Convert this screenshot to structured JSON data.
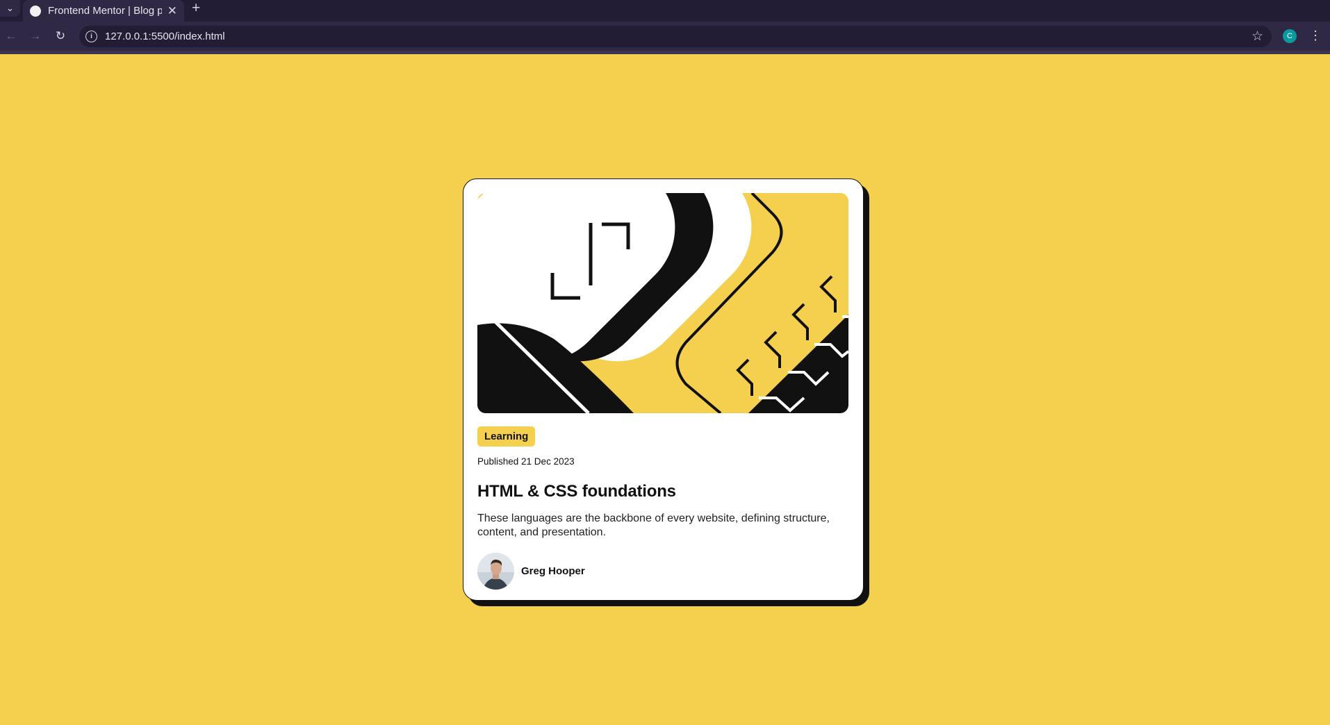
{
  "browser": {
    "tab_title": "Frontend Mentor | Blog preview card",
    "tab_search_icon": "chevron-down-icon",
    "new_tab_icon": "plus-icon",
    "url": "127.0.0.1:5500/index.html",
    "profile_initial": "C",
    "colors": {
      "tabstrip": "#221c35",
      "toolbar": "#2f2946",
      "profile": "#0a9a9e"
    }
  },
  "card": {
    "category": "Learning",
    "published": "Published 21 Dec 2023",
    "title": "HTML & CSS foundations",
    "description": "These languages are the backbone of every website, defining structure, content, and presentation.",
    "author": {
      "name": "Greg Hooper"
    }
  },
  "theme": {
    "background": "#f4d04e",
    "ink": "#111111",
    "card": "#ffffff"
  }
}
